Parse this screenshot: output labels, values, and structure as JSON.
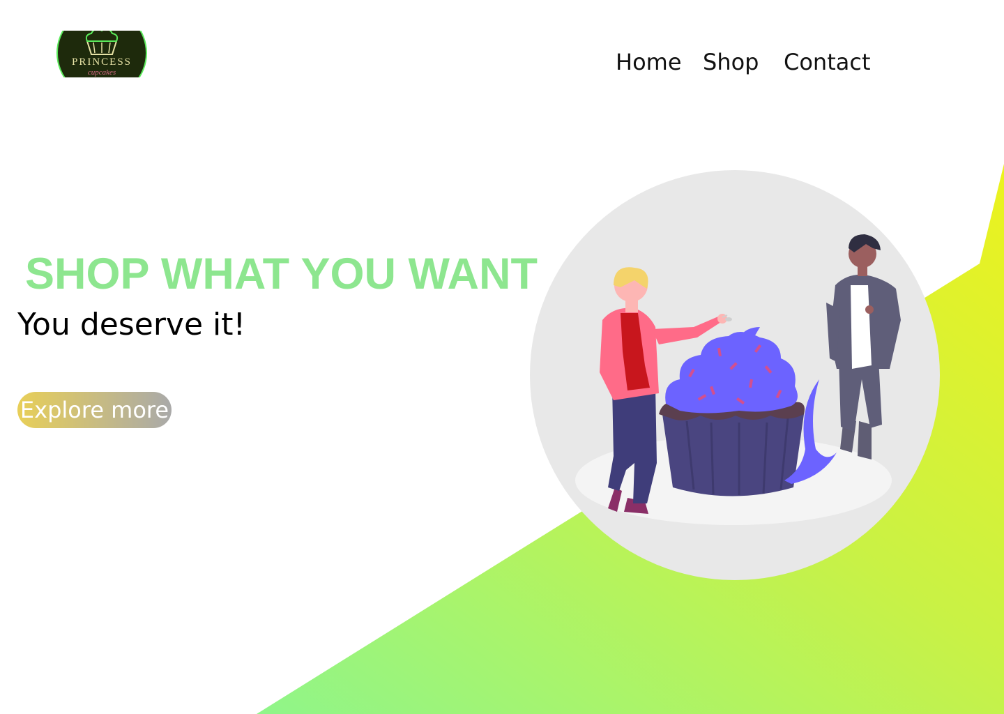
{
  "logo": {
    "title": "PRINCESS",
    "subtitle": "cupcakes"
  },
  "nav": {
    "home": "Home",
    "shop": "Shop",
    "contact": "Contact"
  },
  "hero": {
    "headline": "SHOP WHAT YOU WANT",
    "subheadline": "You deserve it!",
    "cta_label": "Explore more"
  },
  "colors": {
    "headline": "#8de68f",
    "background_shape_start": "#8ff58a",
    "background_shape_end": "#ecf21e",
    "button_start": "#e8cf58",
    "button_end": "#a9a9a9",
    "cupcake_frosting": "#6c63ff",
    "cupcake_base": "#4a4580"
  },
  "illustration": {
    "icon": "cupcake-people-illustration"
  }
}
